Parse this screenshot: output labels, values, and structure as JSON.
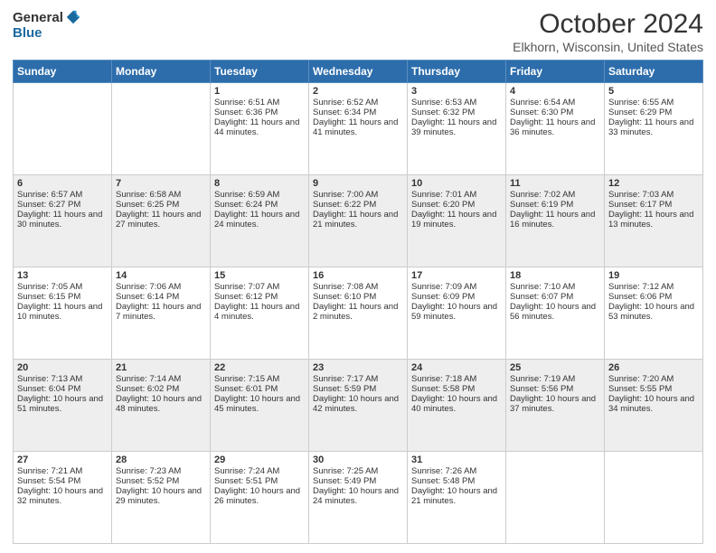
{
  "header": {
    "logo_general": "General",
    "logo_blue": "Blue",
    "month": "October 2024",
    "location": "Elkhorn, Wisconsin, United States"
  },
  "weekdays": [
    "Sunday",
    "Monday",
    "Tuesday",
    "Wednesday",
    "Thursday",
    "Friday",
    "Saturday"
  ],
  "weeks": [
    [
      {
        "day": "",
        "sunrise": "",
        "sunset": "",
        "daylight": ""
      },
      {
        "day": "",
        "sunrise": "",
        "sunset": "",
        "daylight": ""
      },
      {
        "day": "1",
        "sunrise": "Sunrise: 6:51 AM",
        "sunset": "Sunset: 6:36 PM",
        "daylight": "Daylight: 11 hours and 44 minutes."
      },
      {
        "day": "2",
        "sunrise": "Sunrise: 6:52 AM",
        "sunset": "Sunset: 6:34 PM",
        "daylight": "Daylight: 11 hours and 41 minutes."
      },
      {
        "day": "3",
        "sunrise": "Sunrise: 6:53 AM",
        "sunset": "Sunset: 6:32 PM",
        "daylight": "Daylight: 11 hours and 39 minutes."
      },
      {
        "day": "4",
        "sunrise": "Sunrise: 6:54 AM",
        "sunset": "Sunset: 6:30 PM",
        "daylight": "Daylight: 11 hours and 36 minutes."
      },
      {
        "day": "5",
        "sunrise": "Sunrise: 6:55 AM",
        "sunset": "Sunset: 6:29 PM",
        "daylight": "Daylight: 11 hours and 33 minutes."
      }
    ],
    [
      {
        "day": "6",
        "sunrise": "Sunrise: 6:57 AM",
        "sunset": "Sunset: 6:27 PM",
        "daylight": "Daylight: 11 hours and 30 minutes."
      },
      {
        "day": "7",
        "sunrise": "Sunrise: 6:58 AM",
        "sunset": "Sunset: 6:25 PM",
        "daylight": "Daylight: 11 hours and 27 minutes."
      },
      {
        "day": "8",
        "sunrise": "Sunrise: 6:59 AM",
        "sunset": "Sunset: 6:24 PM",
        "daylight": "Daylight: 11 hours and 24 minutes."
      },
      {
        "day": "9",
        "sunrise": "Sunrise: 7:00 AM",
        "sunset": "Sunset: 6:22 PM",
        "daylight": "Daylight: 11 hours and 21 minutes."
      },
      {
        "day": "10",
        "sunrise": "Sunrise: 7:01 AM",
        "sunset": "Sunset: 6:20 PM",
        "daylight": "Daylight: 11 hours and 19 minutes."
      },
      {
        "day": "11",
        "sunrise": "Sunrise: 7:02 AM",
        "sunset": "Sunset: 6:19 PM",
        "daylight": "Daylight: 11 hours and 16 minutes."
      },
      {
        "day": "12",
        "sunrise": "Sunrise: 7:03 AM",
        "sunset": "Sunset: 6:17 PM",
        "daylight": "Daylight: 11 hours and 13 minutes."
      }
    ],
    [
      {
        "day": "13",
        "sunrise": "Sunrise: 7:05 AM",
        "sunset": "Sunset: 6:15 PM",
        "daylight": "Daylight: 11 hours and 10 minutes."
      },
      {
        "day": "14",
        "sunrise": "Sunrise: 7:06 AM",
        "sunset": "Sunset: 6:14 PM",
        "daylight": "Daylight: 11 hours and 7 minutes."
      },
      {
        "day": "15",
        "sunrise": "Sunrise: 7:07 AM",
        "sunset": "Sunset: 6:12 PM",
        "daylight": "Daylight: 11 hours and 4 minutes."
      },
      {
        "day": "16",
        "sunrise": "Sunrise: 7:08 AM",
        "sunset": "Sunset: 6:10 PM",
        "daylight": "Daylight: 11 hours and 2 minutes."
      },
      {
        "day": "17",
        "sunrise": "Sunrise: 7:09 AM",
        "sunset": "Sunset: 6:09 PM",
        "daylight": "Daylight: 10 hours and 59 minutes."
      },
      {
        "day": "18",
        "sunrise": "Sunrise: 7:10 AM",
        "sunset": "Sunset: 6:07 PM",
        "daylight": "Daylight: 10 hours and 56 minutes."
      },
      {
        "day": "19",
        "sunrise": "Sunrise: 7:12 AM",
        "sunset": "Sunset: 6:06 PM",
        "daylight": "Daylight: 10 hours and 53 minutes."
      }
    ],
    [
      {
        "day": "20",
        "sunrise": "Sunrise: 7:13 AM",
        "sunset": "Sunset: 6:04 PM",
        "daylight": "Daylight: 10 hours and 51 minutes."
      },
      {
        "day": "21",
        "sunrise": "Sunrise: 7:14 AM",
        "sunset": "Sunset: 6:02 PM",
        "daylight": "Daylight: 10 hours and 48 minutes."
      },
      {
        "day": "22",
        "sunrise": "Sunrise: 7:15 AM",
        "sunset": "Sunset: 6:01 PM",
        "daylight": "Daylight: 10 hours and 45 minutes."
      },
      {
        "day": "23",
        "sunrise": "Sunrise: 7:17 AM",
        "sunset": "Sunset: 5:59 PM",
        "daylight": "Daylight: 10 hours and 42 minutes."
      },
      {
        "day": "24",
        "sunrise": "Sunrise: 7:18 AM",
        "sunset": "Sunset: 5:58 PM",
        "daylight": "Daylight: 10 hours and 40 minutes."
      },
      {
        "day": "25",
        "sunrise": "Sunrise: 7:19 AM",
        "sunset": "Sunset: 5:56 PM",
        "daylight": "Daylight: 10 hours and 37 minutes."
      },
      {
        "day": "26",
        "sunrise": "Sunrise: 7:20 AM",
        "sunset": "Sunset: 5:55 PM",
        "daylight": "Daylight: 10 hours and 34 minutes."
      }
    ],
    [
      {
        "day": "27",
        "sunrise": "Sunrise: 7:21 AM",
        "sunset": "Sunset: 5:54 PM",
        "daylight": "Daylight: 10 hours and 32 minutes."
      },
      {
        "day": "28",
        "sunrise": "Sunrise: 7:23 AM",
        "sunset": "Sunset: 5:52 PM",
        "daylight": "Daylight: 10 hours and 29 minutes."
      },
      {
        "day": "29",
        "sunrise": "Sunrise: 7:24 AM",
        "sunset": "Sunset: 5:51 PM",
        "daylight": "Daylight: 10 hours and 26 minutes."
      },
      {
        "day": "30",
        "sunrise": "Sunrise: 7:25 AM",
        "sunset": "Sunset: 5:49 PM",
        "daylight": "Daylight: 10 hours and 24 minutes."
      },
      {
        "day": "31",
        "sunrise": "Sunrise: 7:26 AM",
        "sunset": "Sunset: 5:48 PM",
        "daylight": "Daylight: 10 hours and 21 minutes."
      },
      {
        "day": "",
        "sunrise": "",
        "sunset": "",
        "daylight": ""
      },
      {
        "day": "",
        "sunrise": "",
        "sunset": "",
        "daylight": ""
      }
    ]
  ]
}
